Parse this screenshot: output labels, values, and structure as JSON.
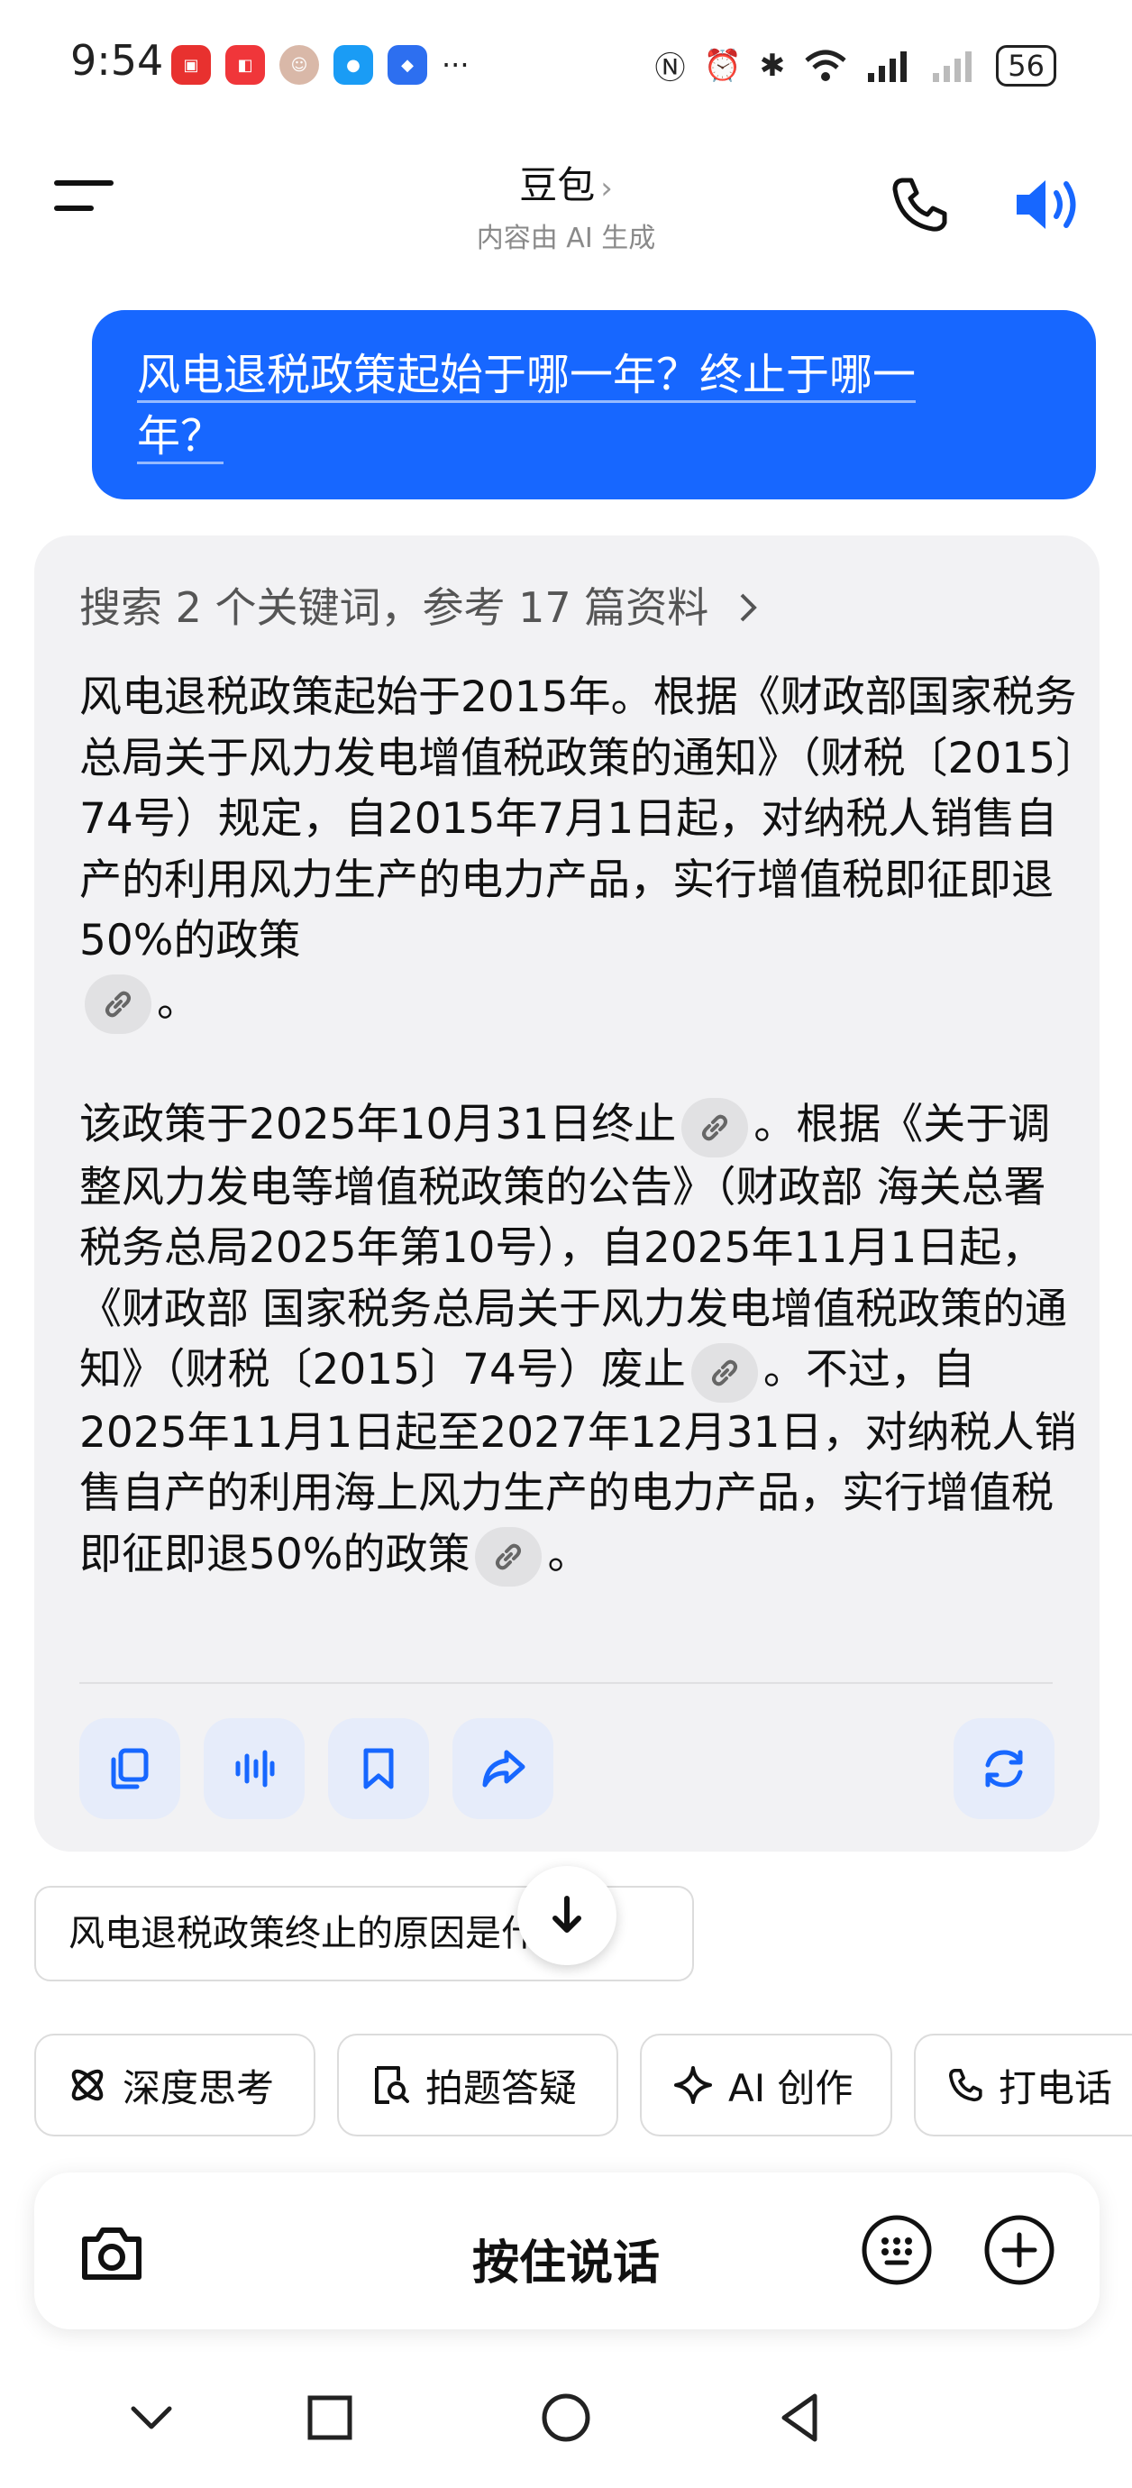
{
  "status_bar": {
    "time": "9:54",
    "battery": "56",
    "more": "···"
  },
  "header": {
    "title": "豆包",
    "title_chevron": "›",
    "subtitle": "内容由 AI 生成"
  },
  "user_message": {
    "line1": "风电退税政策起始于哪一年？终止于哪一",
    "line2": "年？"
  },
  "answer": {
    "search_summary": "搜索 2 个关键词，参考 17 篇资料",
    "p1_text": "风电退税政策起始于2015年。根据《财政部国家税务总局关于风力发电增值税政策的通知》（财税〔2015〕74号）规定，自2015年7月1日起，对纳税人销售自产的利用风力生产的电力产品，实行增值税即征即退50%的政策",
    "p1_end": "。",
    "p2_a": "该政策于2025年10月31日终止",
    "p2_b": "。根据《关于调整风力发电等增值税政策的公告》（财政部 海关总署 税务总局2025年第10号），自2025年11月1日起，《财政部 国家税务总局关于风力发电增值税政策的通知》（财税〔2015〕74号）废止",
    "p2_c": "。不过，自2025年11月1日起至2027年12月31日，对纳税人销售自产的利用海上风力生产的电力产品，实行增值税即征即退50%的政策",
    "p2_end": "。"
  },
  "suggestion": "风电退税政策终止的原因是什么？",
  "chips": [
    "深度思考",
    "拍题答疑",
    "AI 创作",
    "打电话"
  ],
  "input_bar": {
    "hold_to_talk": "按住说话"
  },
  "colors": {
    "accent": "#1767ff",
    "card_bg": "#f2f2f4",
    "action_btn_bg": "#e6ecfa"
  }
}
